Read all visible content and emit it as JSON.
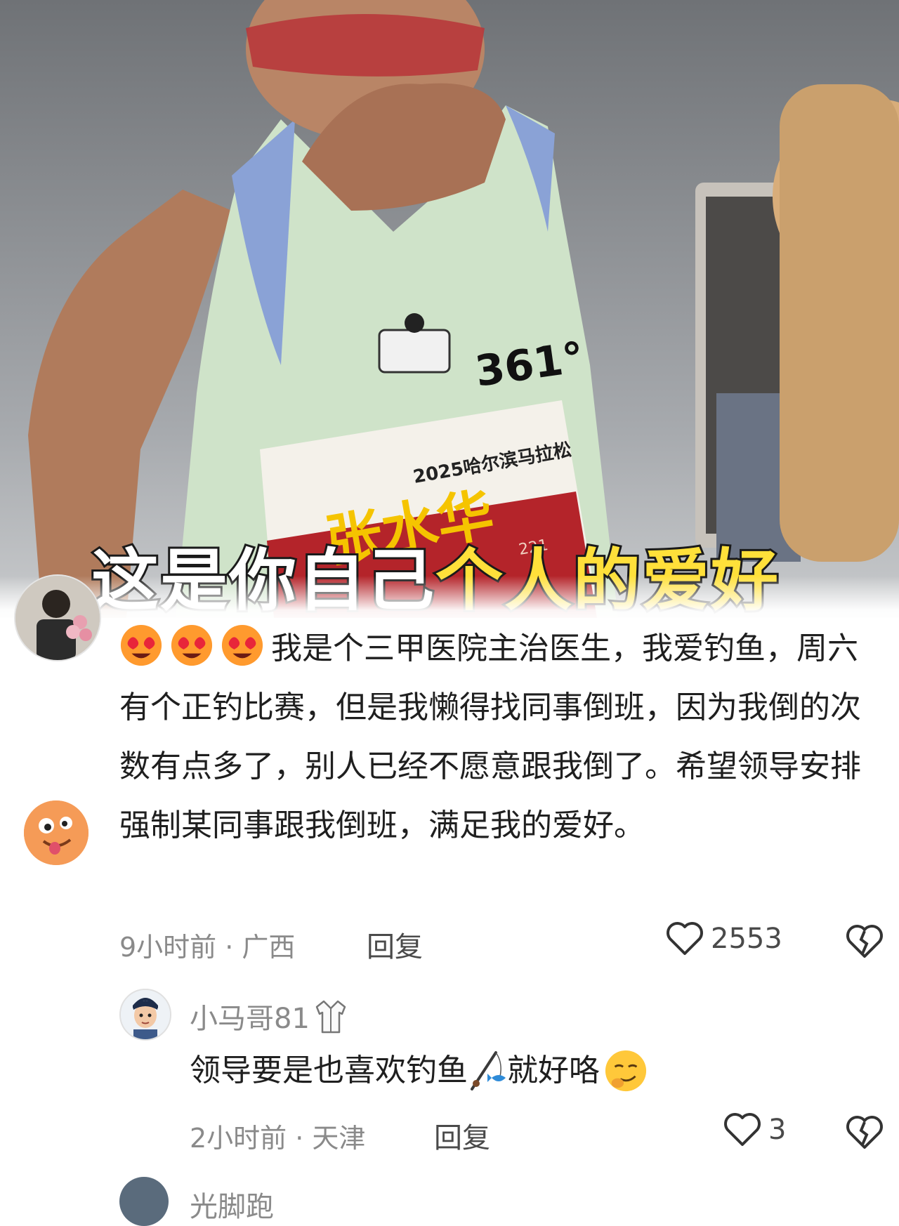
{
  "video": {
    "bib_number": "361°",
    "bib_event": "2025哈尔滨马拉松",
    "bib_name": "张水华",
    "bib_suffix": "221",
    "caption_part1": "这是你自己",
    "caption_part2": "个人的爱好"
  },
  "comment": {
    "emoji_icon": "heart-eyes-face-icon",
    "text": "我是个三甲医院主治医生，我爱钓鱼，周六有个正钓比赛，但是我懒得找同事倒班，因为我倒的次数有点多了，别人已经不愿意跟我倒了。希望领导安排强制某同事跟我倒班，满足我的爱好。",
    "time_location": "9小时前 · 广西",
    "reply_label": "回复",
    "like_count": "2553"
  },
  "reply": {
    "username": "小马哥81",
    "badge_icon": "doctor-coat-icon",
    "text_before": "领导要是也喜欢钓鱼",
    "fishing_icon": "fishing-rod-icon",
    "text_after": "就好咯",
    "smirk_icon": "smirking-face-icon",
    "time_location": "2小时前 · 天津",
    "reply_label": "回复",
    "like_count": "3"
  },
  "next_reply": {
    "username": "光脚跑"
  },
  "colors": {
    "caption_yellow": "#ffe03a",
    "text_primary": "#1f1f1f",
    "text_meta": "#8a8a8a"
  }
}
